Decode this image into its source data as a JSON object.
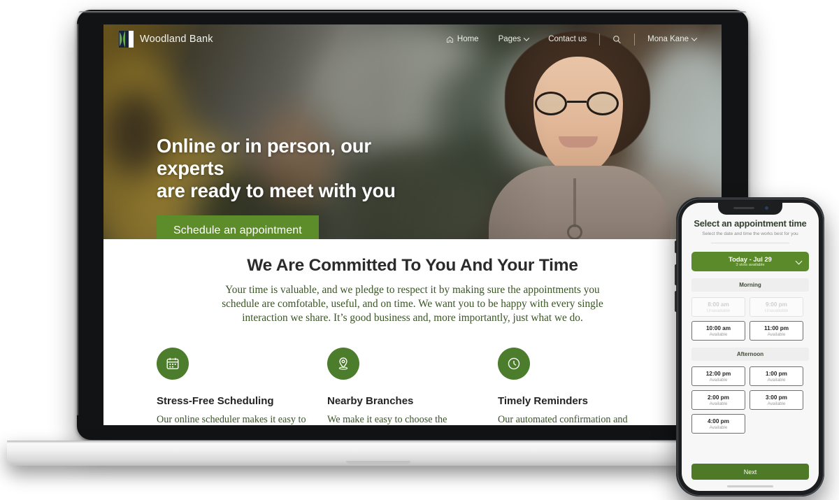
{
  "site": {
    "brand": {
      "name": "Woodland Bank",
      "logo_icon": "woodland-leaf-logo"
    },
    "nav": {
      "items": [
        {
          "label": "Home",
          "icon": "home-icon",
          "has_chevron": false
        },
        {
          "label": "Pages",
          "icon": null,
          "has_chevron": true
        },
        {
          "label": "Contact us",
          "icon": null,
          "has_chevron": false
        }
      ],
      "search_icon": "search-icon",
      "user": {
        "name": "Mona Kane",
        "has_chevron": true
      }
    },
    "hero": {
      "heading_line1": "Online or in person, our experts",
      "heading_line2": "are ready to meet with you",
      "cta_label": "Schedule an appointment",
      "cta_color": "#5d8c2a"
    },
    "committed": {
      "heading": "We Are Committed To You And Your Time",
      "paragraph": "Your time is valuable, and we pledge to respect it by making sure the appointments you schedule are comfotable, useful, and on time. We want you to be happy with every single interaction we share. It’s good business and, more importantly, just what we do.",
      "text_color": "#3a5425"
    },
    "features": [
      {
        "icon": "calendar-icon",
        "title": "Stress-Free Scheduling",
        "text": "Our online scheduler makes it easy to get the meeting time"
      },
      {
        "icon": "map-pin-icon",
        "title": "Nearby Branches",
        "text": "We make it easy to choose the location to meet that is"
      },
      {
        "icon": "clock-icon",
        "title": "Timely Reminders",
        "text": "Our automated confirmation and reminder messages helps"
      }
    ]
  },
  "phone": {
    "title": "Select an appointment time",
    "subtitle": "Select the date and time the works best for you",
    "date_selector": {
      "label": "Today - Jul 29",
      "sublabel": "3 slots available",
      "chevron_icon": "chevron-down-icon",
      "color": "#5b8a2b"
    },
    "sections": [
      {
        "band": "Morning",
        "slots": [
          {
            "time": "8:00 am",
            "status": "Unavailable",
            "available": false
          },
          {
            "time": "9:00 pm",
            "status": "Unavailable",
            "available": false
          },
          {
            "time": "10:00 am",
            "status": "Available",
            "available": true
          },
          {
            "time": "11:00 pm",
            "status": "Available",
            "available": true
          }
        ]
      },
      {
        "band": "Afternoon",
        "slots": [
          {
            "time": "12:00 pm",
            "status": "Available",
            "available": true
          },
          {
            "time": "1:00 pm",
            "status": "Available",
            "available": true
          },
          {
            "time": "2:00 pm",
            "status": "Available",
            "available": true
          },
          {
            "time": "3:00 pm",
            "status": "Available",
            "available": true
          },
          {
            "time": "4:00 pm",
            "status": "Available",
            "available": true
          }
        ]
      }
    ],
    "next_label": "Next"
  }
}
